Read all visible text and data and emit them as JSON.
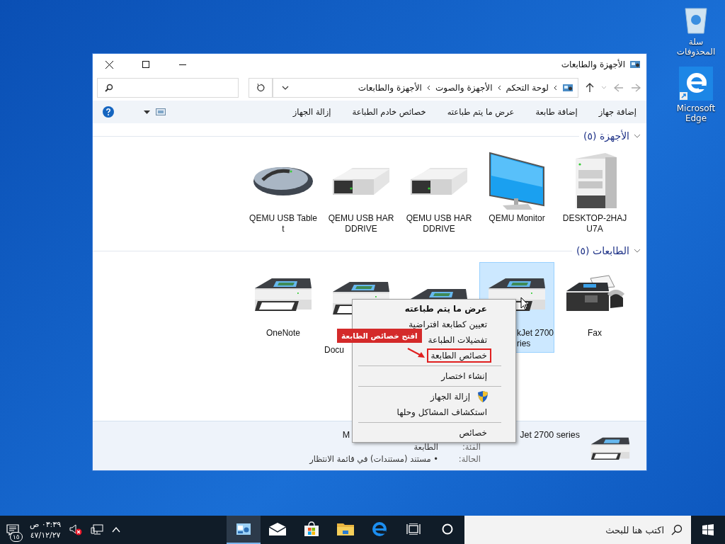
{
  "desktop_icons": [
    {
      "kind": "recycle",
      "label": "سلة المحذوفات"
    },
    {
      "kind": "edge",
      "label": "Microsoft Edge"
    }
  ],
  "window": {
    "title": "الأجهزة والطابعات"
  },
  "address": {
    "crumbs": [
      "لوحة التحكم",
      "الأجهزة والصوت",
      "الأجهزة والطابعات"
    ]
  },
  "toolbar": [
    "إضافة جهاز",
    "إضافة طابعة",
    "عرض ما يتم طباعته",
    "خصائص خادم الطباعة",
    "إزالة الجهاز"
  ],
  "sections": [
    {
      "title": "الأجهزة (٥)",
      "expanded": true,
      "items": [
        {
          "kind": "tower",
          "label": "DESKTOP-2HAJU7A",
          "selected": false
        },
        {
          "kind": "monitor",
          "label": "QEMU Monitor",
          "selected": false
        },
        {
          "kind": "drive",
          "label": "QEMU USB HARDDRIVE",
          "selected": false
        },
        {
          "kind": "drive",
          "label": "QEMU USB HARDDRIVE",
          "selected": false
        },
        {
          "kind": "mouse",
          "label": "QEMU USB Tablet",
          "selected": false
        }
      ]
    },
    {
      "title": "الطابعات (٥)",
      "expanded": true,
      "items": [
        {
          "kind": "fax",
          "label": "Fax",
          "selected": false
        },
        {
          "kind": "printer",
          "label": "kJet 2700 ries",
          "selected": true
        },
        {
          "kind": "printer",
          "selected": false
        },
        {
          "kind": "printer",
          "label": "Docu",
          "selected": false
        },
        {
          "kind": "printer",
          "label": "OneNote",
          "selected": false
        }
      ]
    }
  ],
  "context_menu": [
    {
      "kind": "item",
      "label": "عرض ما يتم طباعته",
      "default": true,
      "boxed": false,
      "shield": false
    },
    {
      "kind": "item",
      "label": "تعيين كطابعة افتراضية",
      "default": false,
      "boxed": false,
      "shield": false
    },
    {
      "kind": "item",
      "label": "تفضيلات الطباعة",
      "default": false,
      "boxed": false,
      "shield": false
    },
    {
      "kind": "item",
      "label": "خصائص الطابعة",
      "default": false,
      "boxed": true,
      "shield": false
    },
    {
      "kind": "separator"
    },
    {
      "kind": "item",
      "label": "إنشاء اختصار",
      "default": false,
      "boxed": false,
      "shield": false
    },
    {
      "kind": "separator"
    },
    {
      "kind": "item",
      "label": "إزالة الجهاز",
      "default": false,
      "boxed": false,
      "shield": true
    },
    {
      "kind": "item",
      "label": "استكشاف المشاكل وحلها",
      "default": false,
      "boxed": false,
      "shield": false
    },
    {
      "kind": "separator"
    },
    {
      "kind": "item",
      "label": "خصائص",
      "default": false,
      "boxed": false,
      "shield": false
    }
  ],
  "annotation": {
    "text": "افتح خصائص الطابعة"
  },
  "details": {
    "name_end": "Jet 2700 series",
    "name_start": "M",
    "fields": [
      {
        "label": "الفئة:",
        "value": "الطابعة"
      },
      {
        "label": "الحالة:",
        "value": "• مستند (مستندات) في قائمة الانتظار"
      }
    ]
  },
  "taskbar": {
    "search_placeholder": "اكتب هنا للبحث",
    "apps": [
      {
        "kind": "cortana",
        "selected": false
      },
      {
        "kind": "taskview",
        "selected": false
      },
      {
        "kind": "edge",
        "selected": false
      },
      {
        "kind": "folder",
        "selected": false
      },
      {
        "kind": "store",
        "selected": false
      },
      {
        "kind": "mail",
        "selected": false
      },
      {
        "kind": "control",
        "selected": true
      }
    ],
    "time": "٠٣:٣٩ ص",
    "date": "٤٧/١٢/٢٧",
    "notifications": "١٥"
  }
}
